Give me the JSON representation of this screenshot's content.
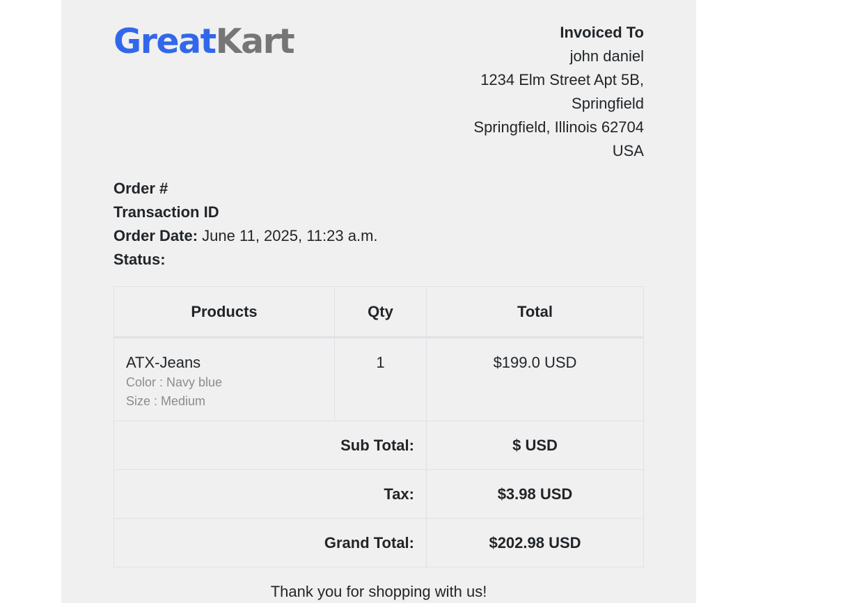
{
  "brand": {
    "part1": "Great",
    "part2": "Kart",
    "color1": "#3167eb",
    "color2": "#767676"
  },
  "invoice_to": {
    "heading": "Invoiced To",
    "name": "john daniel",
    "address1": "1234 Elm Street Apt 5B,",
    "address2": "Springfield",
    "city_line": "Springfield, Illinois 62704",
    "country": "USA"
  },
  "order": {
    "number_label": "Order #",
    "txn_label": "Transaction ID",
    "date_label": "Order Date:",
    "date_value": "June 11, 2025, 11:23 a.m.",
    "status_label": "Status:"
  },
  "table": {
    "headers": [
      "Products",
      "Qty",
      "Total"
    ],
    "rows": [
      {
        "name": "ATX-Jeans",
        "color": "Color : Navy blue",
        "size": "Size : Medium",
        "qty": "1",
        "total": "$199.0 USD"
      }
    ],
    "subtotal_label": "Sub Total:",
    "subtotal_value": "$ USD",
    "tax_label": "Tax:",
    "tax_value": "$3.98 USD",
    "grand_label": "Grand Total:",
    "grand_value": "$202.98 USD"
  },
  "footer": {
    "thanks": "Thank you for shopping with us!"
  }
}
